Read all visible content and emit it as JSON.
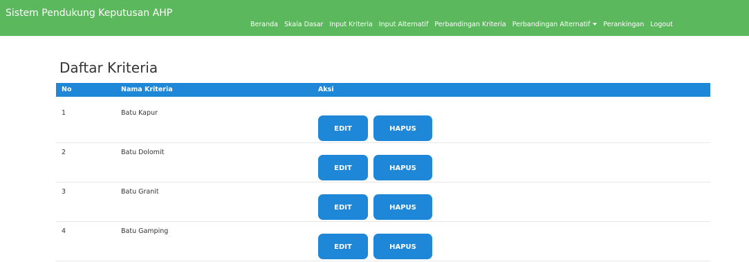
{
  "app_title": "Sistem Pendukung Keputusan AHP",
  "nav": {
    "items": [
      {
        "label": "Beranda"
      },
      {
        "label": "Skala Dasar"
      },
      {
        "label": "Input Kriteria"
      },
      {
        "label": "Input Alternatif"
      },
      {
        "label": "Perbandingan Kriteria"
      },
      {
        "label": "Perbandingan Alternatif",
        "dropdown": true
      },
      {
        "label": "Perankingan"
      },
      {
        "label": "Logout"
      }
    ]
  },
  "page_title": "Daftar Kriteria",
  "table": {
    "headers": {
      "no": "No",
      "nama": "Nama Kriteria",
      "aksi": "Aksi"
    },
    "rows": [
      {
        "no": "1",
        "nama": "Batu Kapur"
      },
      {
        "no": "2",
        "nama": "Batu Dolomit"
      },
      {
        "no": "3",
        "nama": "Batu Granit"
      },
      {
        "no": "4",
        "nama": "Batu Gamping"
      }
    ],
    "edit_label": "EDIT",
    "hapus_label": "HAPUS"
  },
  "colors": {
    "navbar": "#5cb85c",
    "primary": "#1e87d8"
  }
}
